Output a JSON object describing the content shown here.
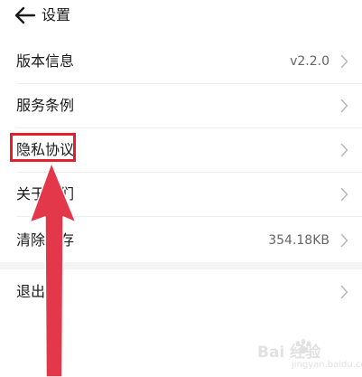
{
  "header": {
    "title": "设置",
    "back_icon": "arrow-left-icon"
  },
  "settings": {
    "items": [
      {
        "label": "版本信息",
        "value": "v2.2.0"
      },
      {
        "label": "服务条例",
        "value": ""
      },
      {
        "label": "隐私协议",
        "value": ""
      },
      {
        "label": "关于我们",
        "value": ""
      },
      {
        "label": "清除缓存",
        "value": "354.18KB"
      }
    ],
    "logout": {
      "label": "退出"
    }
  },
  "annotation": {
    "highlight_color": "#e21f2a",
    "arrow_color": "#e2384a"
  },
  "watermark": {
    "text": "Bai 经验",
    "sub": "jingyan.baidu.com"
  }
}
